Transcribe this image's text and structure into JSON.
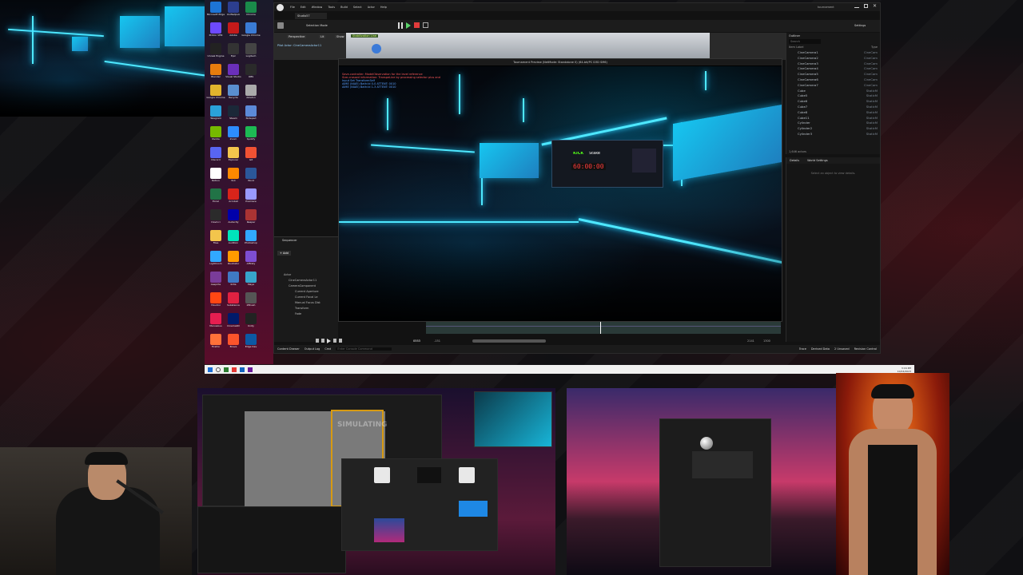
{
  "desktop": {
    "icons": [
      {
        "label": "Microsoft Edge",
        "color": "#1d74d6"
      },
      {
        "label": "Unifiedpub",
        "color": "#2c3e8f"
      },
      {
        "label": "Chrome",
        "color": "#1a8a4a"
      },
      {
        "label": "Proton VPN",
        "color": "#6d4aff"
      },
      {
        "label": "Adobe",
        "color": "#c41a1a"
      },
      {
        "label": "Google Chrome",
        "color": "#3a7bd5"
      },
      {
        "label": "Unreal Engine",
        "color": "#222222"
      },
      {
        "label": "Epic",
        "color": "#333333"
      },
      {
        "label": "Logitech",
        "color": "#444444"
      },
      {
        "label": "Blender",
        "color": "#e87d0d"
      },
      {
        "label": "Visual Studio",
        "color": "#6b2fbb"
      },
      {
        "label": "OBS",
        "color": "#2a2a2a"
      },
      {
        "label": "Google Chrome",
        "color": "#e2b42d"
      },
      {
        "label": "Recycle",
        "color": "#5a8fd0"
      },
      {
        "label": "Ableton",
        "color": "#aaaaaa"
      },
      {
        "label": "Telegram",
        "color": "#2aa1da"
      },
      {
        "label": "Steam",
        "color": "#1b2838"
      },
      {
        "label": "Notepad",
        "color": "#5c8ad8"
      },
      {
        "label": "Nvidia",
        "color": "#76b900"
      },
      {
        "label": "Zoom",
        "color": "#2d8cff"
      },
      {
        "label": "Spotify",
        "color": "#1db954"
      },
      {
        "label": "Discord",
        "color": "#5865f2"
      },
      {
        "label": "Explorer",
        "color": "#f3c54c"
      },
      {
        "label": "Git",
        "color": "#f05133"
      },
      {
        "label": "Notion",
        "color": "#ffffff"
      },
      {
        "label": "VLC",
        "color": "#ff8800"
      },
      {
        "label": "Word",
        "color": "#2b579a"
      },
      {
        "label": "Excel",
        "color": "#217346"
      },
      {
        "label": "Acrobat",
        "color": "#d9241a"
      },
      {
        "label": "Premiere",
        "color": "#9999ff"
      },
      {
        "label": "Davinci",
        "color": "#2b2b2b"
      },
      {
        "label": "Audacity",
        "color": "#0000aa"
      },
      {
        "label": "Reaper",
        "color": "#aa3333"
      },
      {
        "label": "Files",
        "color": "#f3c54c"
      },
      {
        "label": "Audition",
        "color": "#00e4bb"
      },
      {
        "label": "Photoshop",
        "color": "#31a8ff"
      },
      {
        "label": "Lightroom",
        "color": "#31a8ff"
      },
      {
        "label": "Illustrator",
        "color": "#ff9a00"
      },
      {
        "label": "Affinity",
        "color": "#7e4dd2"
      },
      {
        "label": "Aseprite",
        "color": "#7a3c99"
      },
      {
        "label": "Krita",
        "color": "#3f79c4"
      },
      {
        "label": "Maya",
        "color": "#37a5cc"
      },
      {
        "label": "Houdini",
        "color": "#ff4713"
      },
      {
        "label": "Substance",
        "color": "#e02141"
      },
      {
        "label": "ZBrush",
        "color": "#555555"
      },
      {
        "label": "Marvelous",
        "color": "#e61e50"
      },
      {
        "label": "Cinema4D",
        "color": "#011a6a"
      },
      {
        "label": "Unity",
        "color": "#222222"
      },
      {
        "label": "Firefox",
        "color": "#ff7139"
      },
      {
        "label": "Brave",
        "color": "#fb542b"
      },
      {
        "label": "Edge Dev",
        "color": "#0c59a4"
      }
    ]
  },
  "unreal": {
    "window_title": "tournament",
    "project": "Studio57",
    "menu": [
      "File",
      "Edit",
      "Window",
      "Tools",
      "Build",
      "Select",
      "Actor",
      "Help"
    ],
    "selection_mode": "Selection Mode",
    "settings": "Settings",
    "viewport_tabs": [
      "Perspective",
      "Lit",
      "Show"
    ],
    "stabilization": "Stabilization Line",
    "actor_label": "Pilot Actor: CineCameraActor11",
    "preview_title": "Tournament Preview (NetMode: Standalone 0) (64-bit/PC D3D SM6)",
    "log_lines": [
      "Save-controller: ModelObservation for the level reference",
      "Size-crossed information: TranspeLine by processing selector plus and",
      "Input Set TransformSelf",
      "AIME (NIAEI) Bath:Id 0-0 ATTENT: 0010",
      "AIME (NIAEI) Bath:Id 1-3 ATTENT: 0010"
    ],
    "timer": "60:00:00",
    "sign_text": "KICK",
    "sign_sub": "Stake",
    "outliner": {
      "title": "Outliner",
      "search": "Search",
      "col_label": "Item Label",
      "col_type": "Type",
      "rows": [
        {
          "label": "CineCamera1",
          "type": "CineCam"
        },
        {
          "label": "CineCamera2",
          "type": "CineCam"
        },
        {
          "label": "CineCamera3",
          "type": "CineCam"
        },
        {
          "label": "CineCamera4",
          "type": "CineCam"
        },
        {
          "label": "CineCamera5",
          "type": "CineCam"
        },
        {
          "label": "CineCamera6",
          "type": "CineCam"
        },
        {
          "label": "CineCamera7",
          "type": "CineCam"
        },
        {
          "label": "Cube",
          "type": "StaticM"
        },
        {
          "label": "Cube5",
          "type": "StaticM"
        },
        {
          "label": "Cube6",
          "type": "StaticM"
        },
        {
          "label": "Cube7",
          "type": "StaticM"
        },
        {
          "label": "Cube8",
          "type": "StaticM"
        },
        {
          "label": "Cube11",
          "type": "StaticM"
        },
        {
          "label": "Cylinder",
          "type": "StaticM"
        },
        {
          "label": "Cylinder2",
          "type": "StaticM"
        },
        {
          "label": "Cylinder3",
          "type": "StaticM"
        }
      ],
      "count": "1,646 actors"
    },
    "details_tab": "Details",
    "world_settings_tab": "World Settings",
    "details_empty": "Select an object to view details.",
    "sequencer": {
      "title": "Sequencer",
      "add": "+ Add",
      "tracks": [
        "Actor",
        "CineCameraActor11",
        "CameraComponent",
        "Current Aperture",
        "Current Focal Le",
        "Manual Focus Dist",
        "Transform",
        "Fade"
      ],
      "frame": "0553",
      "start": "-151",
      "end": "2141",
      "mid": "1300"
    },
    "status": {
      "content_drawer": "Content Drawer",
      "output_log": "Output Log",
      "cmd": "Cmd",
      "cmd_placeholder": "Enter Console Command",
      "trace": "Trace",
      "derived_data": "Derived Data",
      "unsaved": "2 Unsaved",
      "revision": "Revision Control"
    }
  },
  "taskbar": {
    "time": "3:16 PM",
    "date": "10/24/2023"
  },
  "monitor_left": {
    "simulating": "SIMULATING"
  }
}
